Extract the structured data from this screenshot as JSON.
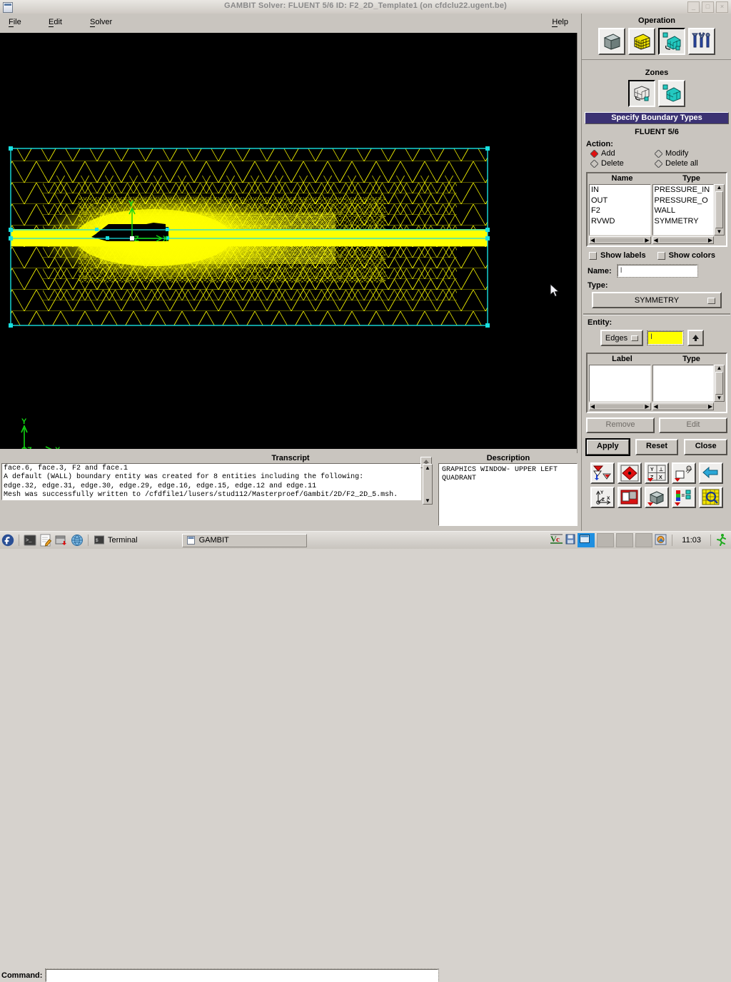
{
  "window": {
    "title": "GAMBIT    Solver: FLUENT 5/6   ID: F2_2D_Template1 (on cfdclu22.ugent.be)",
    "minimize_label": "_",
    "maximize_label": "□",
    "close_label": "×"
  },
  "menubar": {
    "items": [
      {
        "label": "File",
        "mnemonic": "F"
      },
      {
        "label": "Edit",
        "mnemonic": "E"
      },
      {
        "label": "Solver",
        "mnemonic": "S"
      },
      {
        "label": "Help",
        "mnemonic": "H"
      }
    ]
  },
  "operation": {
    "title": "Operation",
    "buttons": [
      {
        "name": "geometry",
        "icon": "gray-cube-icon"
      },
      {
        "name": "mesh",
        "icon": "yellow-mesh-cube-icon"
      },
      {
        "name": "zones",
        "icon": "teal-zones-cube-icon",
        "selected": true
      },
      {
        "name": "tools",
        "icon": "tools-icon"
      }
    ]
  },
  "zones": {
    "title": "Zones",
    "buttons": [
      {
        "name": "specify-boundary-types",
        "icon": "boundary-grid-icon",
        "selected": true
      },
      {
        "name": "specify-continuum-types",
        "icon": "continuum-cube-icon",
        "selected": false
      }
    ]
  },
  "boundary_panel": {
    "header": "Specify Boundary Types",
    "solver": "FLUENT 5/6",
    "action_label": "Action:",
    "actions": [
      {
        "label": "Add",
        "selected": true
      },
      {
        "label": "Modify",
        "selected": false
      },
      {
        "label": "Delete",
        "selected": false
      },
      {
        "label": "Delete all",
        "selected": false
      }
    ],
    "table": {
      "columns": [
        "Name",
        "Type"
      ],
      "rows": [
        {
          "name": "IN",
          "type": "PRESSURE_IN"
        },
        {
          "name": "OUT",
          "type": "PRESSURE_O"
        },
        {
          "name": "F2",
          "type": "WALL"
        },
        {
          "name": "RVWD",
          "type": "SYMMETRY"
        }
      ]
    },
    "show_labels": {
      "label": "Show labels",
      "checked": false
    },
    "show_colors": {
      "label": "Show colors",
      "checked": false
    },
    "name_label": "Name:",
    "name_value": "",
    "type_label": "Type:",
    "type_value": "SYMMETRY",
    "entity_label": "Entity:",
    "entity_kind": "Edges",
    "entity_value": "",
    "entity_up_label": "▲",
    "label_table": {
      "columns": [
        "Label",
        "Type"
      ],
      "rows": []
    },
    "remove_label": "Remove",
    "edit_label": "Edit",
    "apply_label": "Apply",
    "reset_label": "Reset",
    "close_label": "Close"
  },
  "view_toolbar": {
    "row1": [
      {
        "name": "fit-to-window-icon"
      },
      {
        "name": "orient-model-icon"
      },
      {
        "name": "xyz-axis-views-icon"
      },
      {
        "name": "render-model-icon"
      },
      {
        "name": "undo-view-icon"
      }
    ],
    "row2": [
      {
        "name": "coordinate-axis-icon"
      },
      {
        "name": "annotation-icon"
      },
      {
        "name": "shaded-cube-icon"
      },
      {
        "name": "color-legend-icon"
      },
      {
        "name": "examine-mesh-icon"
      }
    ]
  },
  "graphics": {
    "axis_labels": {
      "x": "X",
      "y": "Y",
      "z": "Z"
    },
    "mesh_overlay_labels": [
      "Y",
      "Z",
      "X"
    ],
    "mesh_color": "#ffff00",
    "boundary_color": "#18e0e0",
    "axis_color": "#00dd00",
    "background": "#000000"
  },
  "transcript": {
    "title": "Transcript",
    "lines": [
      "face.6, face.3, F2 and face.1",
      "A default (WALL) boundary entity was created for 8 entities including the following:",
      "edge.32, edge.31, edge.30, edge.29, edge.16, edge.15, edge.12 and edge.11",
      "Mesh was successfully written to /cfdfile1/lusers/stud112/Masterproef/Gambit/2D/F2_2D_5.msh."
    ],
    "command_label": "Command:",
    "command_value": "",
    "scroll_up_label": "▲"
  },
  "description": {
    "title": "Description",
    "lines": [
      "GRAPHICS WINDOW- UPPER LEFT",
      "QUADRANT"
    ]
  },
  "taskbar": {
    "launchers": [
      {
        "name": "fedora-menu-icon"
      },
      {
        "name": "terminal-launcher-icon"
      },
      {
        "name": "text-editor-launcher-icon"
      },
      {
        "name": "package-manager-launcher-icon"
      },
      {
        "name": "web-browser-launcher-icon"
      }
    ],
    "terminal_task": "Terminal",
    "window_task": "GAMBIT",
    "tray": [
      {
        "name": "vlc-tray-icon"
      },
      {
        "name": "floppy-tray-icon"
      },
      {
        "name": "desktop-1-icon"
      },
      {
        "name": "desktop-2-icon"
      },
      {
        "name": "desktop-3-icon"
      },
      {
        "name": "desktop-4-icon"
      },
      {
        "name": "image-viewer-tray-icon"
      }
    ],
    "clock": "11:03",
    "runner_icon": "running-man-icon"
  }
}
